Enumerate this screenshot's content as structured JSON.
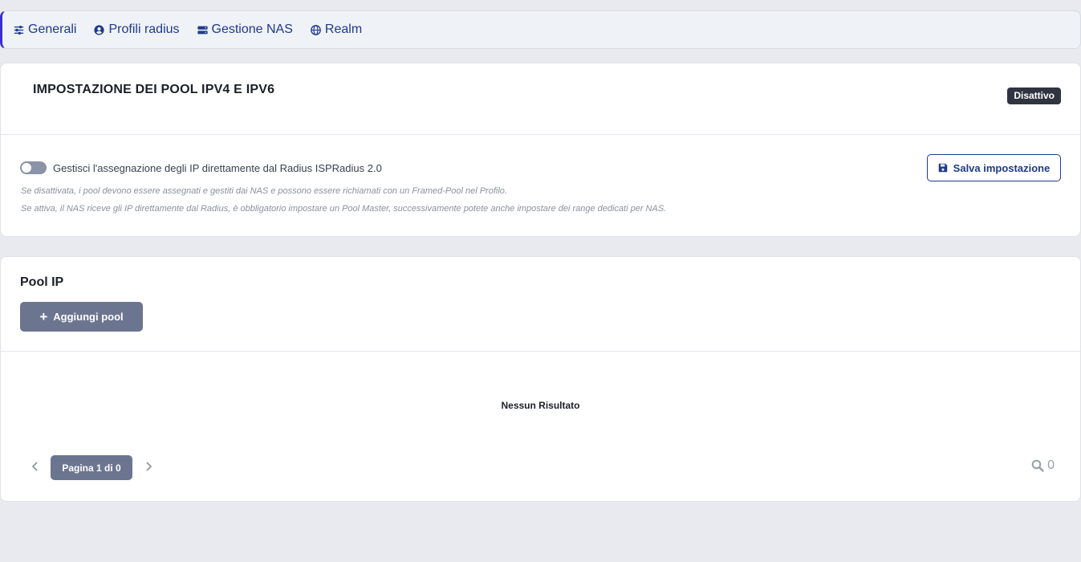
{
  "nav": {
    "items": [
      {
        "label": "Generali",
        "icon": "sliders-icon"
      },
      {
        "label": "Profili radius",
        "icon": "user-circle-icon"
      },
      {
        "label": "Gestione NAS",
        "icon": "server-icon"
      },
      {
        "label": "Realm",
        "icon": "globe-icon"
      }
    ]
  },
  "settings": {
    "title": "IMPOSTAZIONE DEI POOL IPV4 E IPV6",
    "status_badge": "Disattivo",
    "toggle_label": "Gestisci l'assegnazione degli IP direttamente dal Radius ISPRadius 2.0",
    "toggle_on": false,
    "hint_off": "Se disattivata, i pool devono essere assegnati e gestiti dai NAS e possono essere richiamati con un Framed-Pool nel Profilo.",
    "hint_on": "Se attiva, il NAS riceve gli IP direttamente dal Radius, è obbligatorio impostare un Pool Master, successivamente potete anche impostare dei range dedicati per NAS.",
    "save_label": "Salva impostazione"
  },
  "pool": {
    "title": "Pool IP",
    "add_label": "Aggiungi pool",
    "empty_text": "Nessun Risultato",
    "page_label": "Pagina 1 di 0",
    "result_count": "0"
  },
  "colors": {
    "accent": "#1e3a8a",
    "nav_border": "#3a2fc9",
    "muted_button": "#6c7590",
    "badge": "#2f3440"
  }
}
